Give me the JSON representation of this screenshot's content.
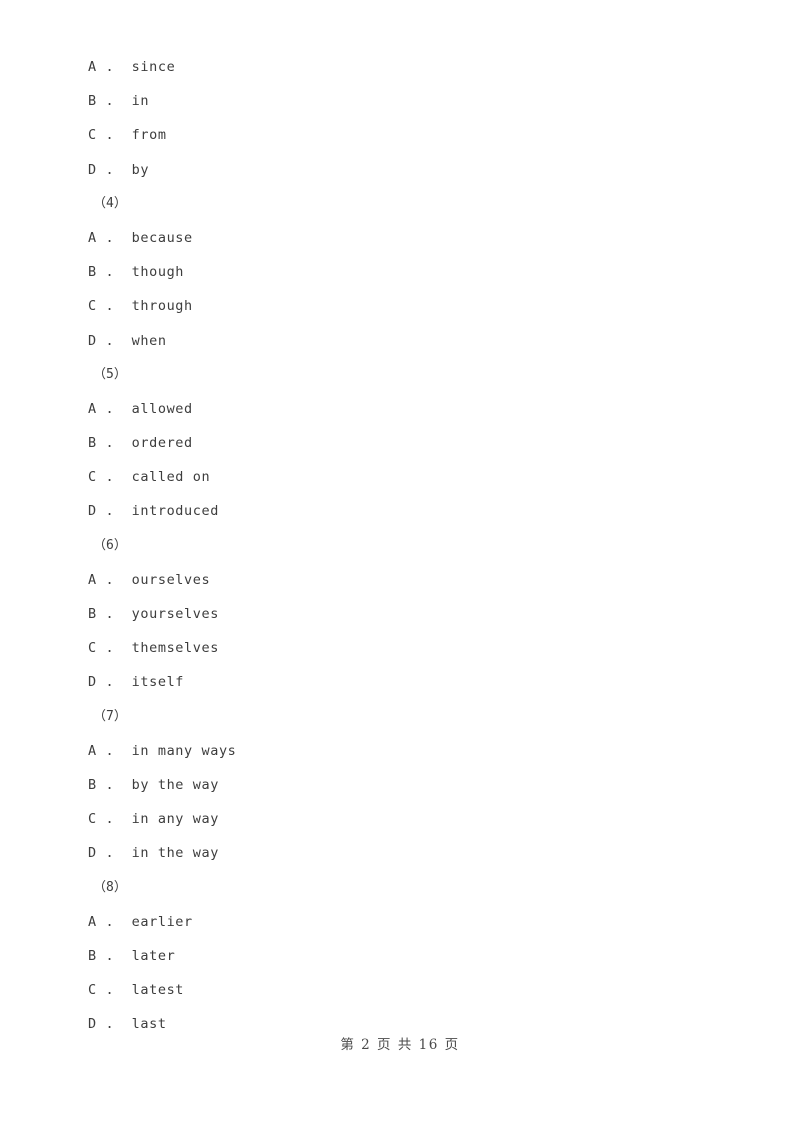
{
  "document": {
    "page_background": "#ffffff",
    "text_color": "#3d3d3d"
  },
  "body": {
    "lines": [
      {
        "kind": "option",
        "letter": "A",
        "sep": " .",
        "text": "since"
      },
      {
        "kind": "option",
        "letter": "B",
        "sep": " .",
        "text": "in"
      },
      {
        "kind": "option",
        "letter": "C",
        "sep": " .",
        "text": "from"
      },
      {
        "kind": "option",
        "letter": "D",
        "sep": " .",
        "text": "by"
      },
      {
        "kind": "qnum",
        "text": "（4）"
      },
      {
        "kind": "option",
        "letter": "A",
        "sep": " .",
        "text": "because"
      },
      {
        "kind": "option",
        "letter": "B",
        "sep": " .",
        "text": "though"
      },
      {
        "kind": "option",
        "letter": "C",
        "sep": " .",
        "text": "through"
      },
      {
        "kind": "option",
        "letter": "D",
        "sep": " .",
        "text": "when"
      },
      {
        "kind": "qnum",
        "text": "（5）"
      },
      {
        "kind": "option",
        "letter": "A",
        "sep": " .",
        "text": "allowed"
      },
      {
        "kind": "option",
        "letter": "B",
        "sep": " .",
        "text": "ordered"
      },
      {
        "kind": "option",
        "letter": "C",
        "sep": " .",
        "text": "called on"
      },
      {
        "kind": "option",
        "letter": "D",
        "sep": " .",
        "text": "introduced"
      },
      {
        "kind": "qnum",
        "text": "（6）"
      },
      {
        "kind": "option",
        "letter": "A",
        "sep": " .",
        "text": "ourselves"
      },
      {
        "kind": "option",
        "letter": "B",
        "sep": " .",
        "text": "yourselves"
      },
      {
        "kind": "option",
        "letter": "C",
        "sep": " .",
        "text": "themselves"
      },
      {
        "kind": "option",
        "letter": "D",
        "sep": " .",
        "text": "itself"
      },
      {
        "kind": "qnum",
        "text": "（7）"
      },
      {
        "kind": "option",
        "letter": "A",
        "sep": " .",
        "text": "in many ways"
      },
      {
        "kind": "option",
        "letter": "B",
        "sep": " .",
        "text": "by the way"
      },
      {
        "kind": "option",
        "letter": "C",
        "sep": " .",
        "text": "in any way"
      },
      {
        "kind": "option",
        "letter": "D",
        "sep": " .",
        "text": "in the way"
      },
      {
        "kind": "qnum",
        "text": "（8）"
      },
      {
        "kind": "option",
        "letter": "A",
        "sep": " .",
        "text": "earlier"
      },
      {
        "kind": "option",
        "letter": "B",
        "sep": " .",
        "text": "later"
      },
      {
        "kind": "option",
        "letter": "C",
        "sep": " .",
        "text": "latest"
      },
      {
        "kind": "option",
        "letter": "D",
        "sep": " .",
        "text": "last"
      }
    ]
  },
  "footer": {
    "text": "第 2 页 共 16 页",
    "current_page": "2",
    "total_pages": "16"
  }
}
